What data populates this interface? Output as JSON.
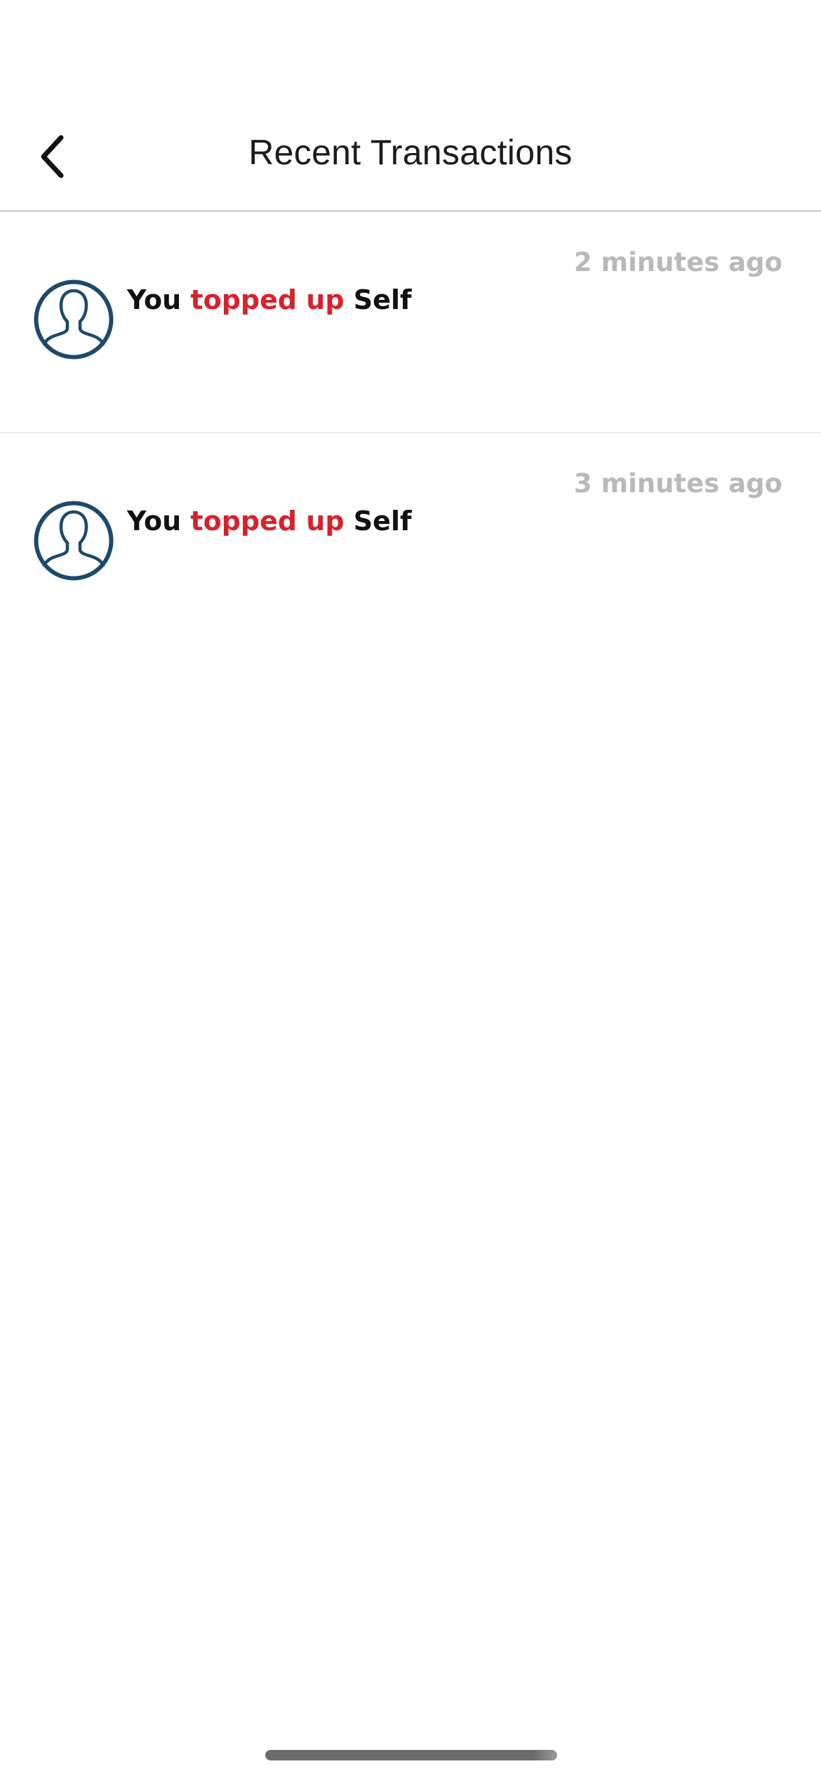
{
  "header": {
    "title": "Recent Transactions",
    "back_icon": "chevron-left-icon"
  },
  "transactions": [
    {
      "subject": "You",
      "action": "topped up",
      "target": "Self",
      "time": "2 minutes ago",
      "avatar_icon": "user-avatar-icon"
    },
    {
      "subject": "You",
      "action": "topped up",
      "target": "Self",
      "time": "3 minutes ago",
      "avatar_icon": "user-avatar-icon"
    }
  ],
  "colors": {
    "action": "#d7222b",
    "avatar": "#1b4a6b",
    "timestamp": "#b9b9b9",
    "divider": "#d4d4d4"
  }
}
